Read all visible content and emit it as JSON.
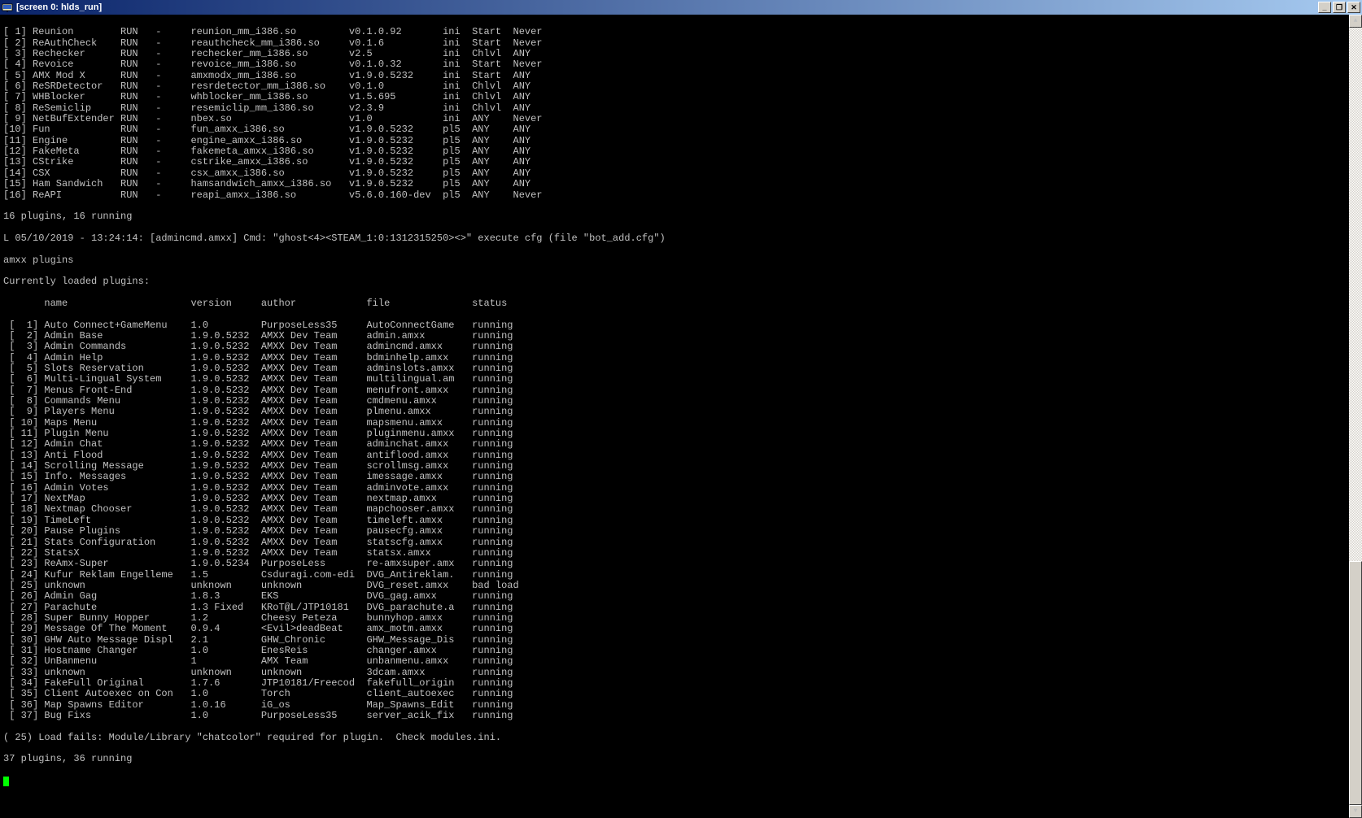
{
  "window": {
    "title": "[screen 0: hlds_run]"
  },
  "meta_rows": [
    {
      "idx": " 1",
      "name": "Reunion",
      "stat": "RUN",
      "dash": "-",
      "file": "reunion_mm_i386.so",
      "ver": "v0.1.0.92",
      "chtype": "ini",
      "load": "Start",
      "unload": "Never"
    },
    {
      "idx": " 2",
      "name": "ReAuthCheck",
      "stat": "RUN",
      "dash": "-",
      "file": "reauthcheck_mm_i386.so",
      "ver": "v0.1.6",
      "chtype": "ini",
      "load": "Start",
      "unload": "Never"
    },
    {
      "idx": " 3",
      "name": "Rechecker",
      "stat": "RUN",
      "dash": "-",
      "file": "rechecker_mm_i386.so",
      "ver": "v2.5",
      "chtype": "ini",
      "load": "Chlvl",
      "unload": "ANY"
    },
    {
      "idx": " 4",
      "name": "Revoice",
      "stat": "RUN",
      "dash": "-",
      "file": "revoice_mm_i386.so",
      "ver": "v0.1.0.32",
      "chtype": "ini",
      "load": "Start",
      "unload": "Never"
    },
    {
      "idx": " 5",
      "name": "AMX Mod X",
      "stat": "RUN",
      "dash": "-",
      "file": "amxmodx_mm_i386.so",
      "ver": "v1.9.0.5232",
      "chtype": "ini",
      "load": "Start",
      "unload": "ANY"
    },
    {
      "idx": " 6",
      "name": "ReSRDetector",
      "stat": "RUN",
      "dash": "-",
      "file": "resrdetector_mm_i386.so",
      "ver": "v0.1.0",
      "chtype": "ini",
      "load": "Chlvl",
      "unload": "ANY"
    },
    {
      "idx": " 7",
      "name": "WHBlocker",
      "stat": "RUN",
      "dash": "-",
      "file": "whblocker_mm_i386.so",
      "ver": "v1.5.695",
      "chtype": "ini",
      "load": "Chlvl",
      "unload": "ANY"
    },
    {
      "idx": " 8",
      "name": "ReSemiclip",
      "stat": "RUN",
      "dash": "-",
      "file": "resemiclip_mm_i386.so",
      "ver": "v2.3.9",
      "chtype": "ini",
      "load": "Chlvl",
      "unload": "ANY"
    },
    {
      "idx": " 9",
      "name": "NetBufExtender",
      "stat": "RUN",
      "dash": "-",
      "file": "nbex.so",
      "ver": "v1.0",
      "chtype": "ini",
      "load": "ANY",
      "unload": "Never"
    },
    {
      "idx": "10",
      "name": "Fun",
      "stat": "RUN",
      "dash": "-",
      "file": "fun_amxx_i386.so",
      "ver": "v1.9.0.5232",
      "chtype": "pl5",
      "load": "ANY",
      "unload": "ANY"
    },
    {
      "idx": "11",
      "name": "Engine",
      "stat": "RUN",
      "dash": "-",
      "file": "engine_amxx_i386.so",
      "ver": "v1.9.0.5232",
      "chtype": "pl5",
      "load": "ANY",
      "unload": "ANY"
    },
    {
      "idx": "12",
      "name": "FakeMeta",
      "stat": "RUN",
      "dash": "-",
      "file": "fakemeta_amxx_i386.so",
      "ver": "v1.9.0.5232",
      "chtype": "pl5",
      "load": "ANY",
      "unload": "ANY"
    },
    {
      "idx": "13",
      "name": "CStrike",
      "stat": "RUN",
      "dash": "-",
      "file": "cstrike_amxx_i386.so",
      "ver": "v1.9.0.5232",
      "chtype": "pl5",
      "load": "ANY",
      "unload": "ANY"
    },
    {
      "idx": "14",
      "name": "CSX",
      "stat": "RUN",
      "dash": "-",
      "file": "csx_amxx_i386.so",
      "ver": "v1.9.0.5232",
      "chtype": "pl5",
      "load": "ANY",
      "unload": "ANY"
    },
    {
      "idx": "15",
      "name": "Ham Sandwich",
      "stat": "RUN",
      "dash": "-",
      "file": "hamsandwich_amxx_i386.so",
      "ver": "v1.9.0.5232",
      "chtype": "pl5",
      "load": "ANY",
      "unload": "ANY"
    },
    {
      "idx": "16",
      "name": "ReAPI",
      "stat": "RUN",
      "dash": "-",
      "file": "reapi_amxx_i386.so",
      "ver": "v5.6.0.160-dev",
      "chtype": "pl5",
      "load": "ANY",
      "unload": "Never"
    }
  ],
  "meta_summary": "16 plugins, 16 running",
  "log_line": "L 05/10/2019 - 13:24:14: [admincmd.amxx] Cmd: \"ghost<4><STEAM_1:0:1312315250><>\" execute cfg (file \"bot_add.cfg\")",
  "cmd_line": "amxx plugins",
  "amxx_header": "Currently loaded plugins:",
  "amxx_cols": {
    "name": "name",
    "version": "version",
    "author": "author",
    "file": "file",
    "status": "status"
  },
  "amxx_rows": [
    {
      "idx": " 1",
      "name": "Auto Connect+GameMenu",
      "ver": "1.0",
      "author": "PurposeLess35",
      "file": "AutoConnectGame",
      "status": "running"
    },
    {
      "idx": " 2",
      "name": "Admin Base",
      "ver": "1.9.0.5232",
      "author": "AMXX Dev Team",
      "file": "admin.amxx",
      "status": "running"
    },
    {
      "idx": " 3",
      "name": "Admin Commands",
      "ver": "1.9.0.5232",
      "author": "AMXX Dev Team",
      "file": "admincmd.amxx",
      "status": "running"
    },
    {
      "idx": " 4",
      "name": "Admin Help",
      "ver": "1.9.0.5232",
      "author": "AMXX Dev Team",
      "file": "bdminhelp.amxx",
      "status": "running"
    },
    {
      "idx": " 5",
      "name": "Slots Reservation",
      "ver": "1.9.0.5232",
      "author": "AMXX Dev Team",
      "file": "adminslots.amxx",
      "status": "running"
    },
    {
      "idx": " 6",
      "name": "Multi-Lingual System",
      "ver": "1.9.0.5232",
      "author": "AMXX Dev Team",
      "file": "multilingual.am",
      "status": "running"
    },
    {
      "idx": " 7",
      "name": "Menus Front-End",
      "ver": "1.9.0.5232",
      "author": "AMXX Dev Team",
      "file": "menufront.amxx",
      "status": "running"
    },
    {
      "idx": " 8",
      "name": "Commands Menu",
      "ver": "1.9.0.5232",
      "author": "AMXX Dev Team",
      "file": "cmdmenu.amxx",
      "status": "running"
    },
    {
      "idx": " 9",
      "name": "Players Menu",
      "ver": "1.9.0.5232",
      "author": "AMXX Dev Team",
      "file": "plmenu.amxx",
      "status": "running"
    },
    {
      "idx": "10",
      "name": "Maps Menu",
      "ver": "1.9.0.5232",
      "author": "AMXX Dev Team",
      "file": "mapsmenu.amxx",
      "status": "running"
    },
    {
      "idx": "11",
      "name": "Plugin Menu",
      "ver": "1.9.0.5232",
      "author": "AMXX Dev Team",
      "file": "pluginmenu.amxx",
      "status": "running"
    },
    {
      "idx": "12",
      "name": "Admin Chat",
      "ver": "1.9.0.5232",
      "author": "AMXX Dev Team",
      "file": "adminchat.amxx",
      "status": "running"
    },
    {
      "idx": "13",
      "name": "Anti Flood",
      "ver": "1.9.0.5232",
      "author": "AMXX Dev Team",
      "file": "antiflood.amxx",
      "status": "running"
    },
    {
      "idx": "14",
      "name": "Scrolling Message",
      "ver": "1.9.0.5232",
      "author": "AMXX Dev Team",
      "file": "scrollmsg.amxx",
      "status": "running"
    },
    {
      "idx": "15",
      "name": "Info. Messages",
      "ver": "1.9.0.5232",
      "author": "AMXX Dev Team",
      "file": "imessage.amxx",
      "status": "running"
    },
    {
      "idx": "16",
      "name": "Admin Votes",
      "ver": "1.9.0.5232",
      "author": "AMXX Dev Team",
      "file": "adminvote.amxx",
      "status": "running"
    },
    {
      "idx": "17",
      "name": "NextMap",
      "ver": "1.9.0.5232",
      "author": "AMXX Dev Team",
      "file": "nextmap.amxx",
      "status": "running"
    },
    {
      "idx": "18",
      "name": "Nextmap Chooser",
      "ver": "1.9.0.5232",
      "author": "AMXX Dev Team",
      "file": "mapchooser.amxx",
      "status": "running"
    },
    {
      "idx": "19",
      "name": "TimeLeft",
      "ver": "1.9.0.5232",
      "author": "AMXX Dev Team",
      "file": "timeleft.amxx",
      "status": "running"
    },
    {
      "idx": "20",
      "name": "Pause Plugins",
      "ver": "1.9.0.5232",
      "author": "AMXX Dev Team",
      "file": "pausecfg.amxx",
      "status": "running"
    },
    {
      "idx": "21",
      "name": "Stats Configuration",
      "ver": "1.9.0.5232",
      "author": "AMXX Dev Team",
      "file": "statscfg.amxx",
      "status": "running"
    },
    {
      "idx": "22",
      "name": "StatsX",
      "ver": "1.9.0.5232",
      "author": "AMXX Dev Team",
      "file": "statsx.amxx",
      "status": "running"
    },
    {
      "idx": "23",
      "name": "ReAmx-Super",
      "ver": "1.9.0.5234",
      "author": "PurposeLess",
      "file": "re-amxsuper.amx",
      "status": "running"
    },
    {
      "idx": "24",
      "name": "Kufur Reklam Engelleme",
      "ver": "1.5",
      "author": "Csduragi.com-edi",
      "file": "DVG_Antireklam.",
      "status": "running"
    },
    {
      "idx": "25",
      "name": "unknown",
      "ver": "unknown",
      "author": "unknown",
      "file": "DVG_reset.amxx",
      "status": "bad load"
    },
    {
      "idx": "26",
      "name": "Admin Gag",
      "ver": "1.8.3",
      "author": "EKS",
      "file": "DVG_gag.amxx",
      "status": "running"
    },
    {
      "idx": "27",
      "name": "Parachute",
      "ver": "1.3 Fixed",
      "author": "KRoT@L/JTP10181",
      "file": "DVG_parachute.a",
      "status": "running"
    },
    {
      "idx": "28",
      "name": "Super Bunny Hopper",
      "ver": "1.2",
      "author": "Cheesy Peteza",
      "file": "bunnyhop.amxx",
      "status": "running"
    },
    {
      "idx": "29",
      "name": "Message Of The Moment",
      "ver": "0.9.4",
      "author": "<Evil>deadBeat",
      "file": "amx_motm.amxx",
      "status": "running"
    },
    {
      "idx": "30",
      "name": "GHW Auto Message Displ",
      "ver": "2.1",
      "author": "GHW_Chronic",
      "file": "GHW_Message_Dis",
      "status": "running"
    },
    {
      "idx": "31",
      "name": "Hostname Changer",
      "ver": "1.0",
      "author": "EnesReis",
      "file": "changer.amxx",
      "status": "running"
    },
    {
      "idx": "32",
      "name": "UnBanmenu",
      "ver": "1",
      "author": "AMX Team",
      "file": "unbanmenu.amxx",
      "status": "running"
    },
    {
      "idx": "33",
      "name": "unknown",
      "ver": "unknown",
      "author": "unknown",
      "file": "3dcam.amxx",
      "status": "running"
    },
    {
      "idx": "34",
      "name": "FakeFull Original",
      "ver": "1.7.6",
      "author": "JTP10181/Freecod",
      "file": "fakefull_origin",
      "status": "running"
    },
    {
      "idx": "35",
      "name": "Client Autoexec on Con",
      "ver": "1.0",
      "author": "Torch",
      "file": "client_autoexec",
      "status": "running"
    },
    {
      "idx": "36",
      "name": "Map Spawns Editor",
      "ver": "1.0.16",
      "author": "iG_os",
      "file": "Map_Spawns_Edit",
      "status": "running"
    },
    {
      "idx": "37",
      "name": "Bug Fixs",
      "ver": "1.0",
      "author": "PurposeLess35",
      "file": "server_acik_fix",
      "status": "running"
    }
  ],
  "load_fail": "( 25) Load fails: Module/Library \"chatcolor\" required for plugin.  Check modules.ini.",
  "amxx_summary": "37 plugins, 36 running"
}
